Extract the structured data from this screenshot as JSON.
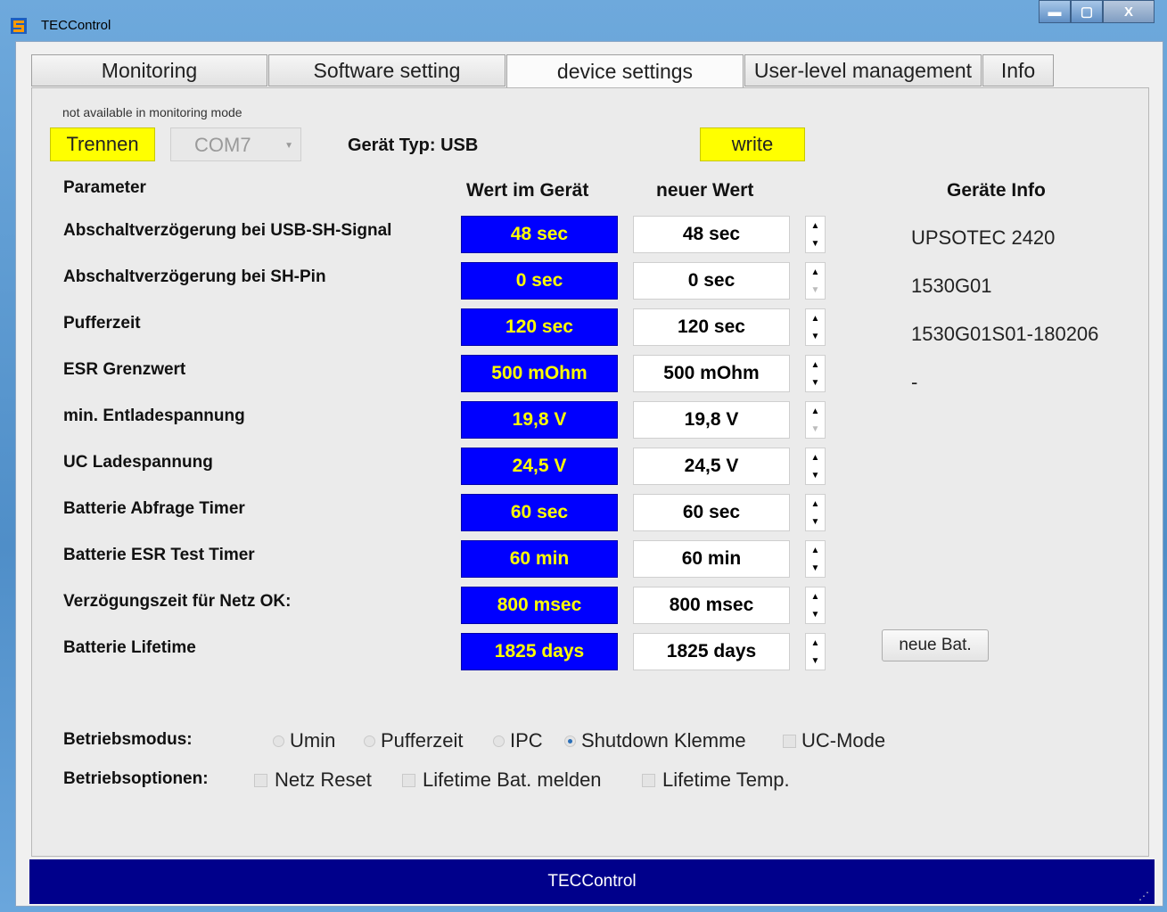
{
  "window": {
    "title": "TECControl"
  },
  "tabs": [
    {
      "label": "Monitoring"
    },
    {
      "label": "Software setting"
    },
    {
      "label": "device settings"
    },
    {
      "label": "User-level management"
    },
    {
      "label": "Info"
    }
  ],
  "toolbar": {
    "note": "not available in monitoring mode",
    "disconnect_label": "Trennen",
    "port_value": "COM7",
    "device_type": "Gerät Typ: USB",
    "write_label": "write"
  },
  "table": {
    "headers": {
      "parameter": "Parameter",
      "device_value": "Wert im Gerät",
      "new_value": "neuer Wert",
      "device_info": "Geräte Info"
    },
    "rows": [
      {
        "label": "Abschaltverzögerung bei USB-SH-Signal",
        "device": "48 sec",
        "new": "48 sec"
      },
      {
        "label": "Abschaltverzögerung bei SH-Pin",
        "device": "0 sec",
        "new": "0 sec"
      },
      {
        "label": "Pufferzeit",
        "device": "120 sec",
        "new": "120 sec"
      },
      {
        "label": "ESR Grenzwert",
        "device": "500 mOhm",
        "new": "500 mOhm"
      },
      {
        "label": "min. Entladespannung",
        "device": "19,8 V",
        "new": "19,8 V"
      },
      {
        "label": "UC Ladespannung",
        "device": "24,5 V",
        "new": "24,5 V"
      },
      {
        "label": "Batterie Abfrage Timer",
        "device": "60 sec",
        "new": "60 sec"
      },
      {
        "label": "Batterie ESR Test Timer",
        "device": "60 min",
        "new": "60 min"
      },
      {
        "label": "Verzögungszeit für Netz OK:",
        "device": "800 msec",
        "new": "800 msec"
      },
      {
        "label": "Batterie Lifetime",
        "device": "1825 days",
        "new": "1825 days"
      }
    ]
  },
  "device_info": [
    "UPSOTEC 2420",
    "1530G01",
    "1530G01S01-180206",
    "-"
  ],
  "new_battery_label": "neue Bat.",
  "mode": {
    "label": "Betriebsmodus:",
    "options": [
      {
        "label": "Umin",
        "selected": false
      },
      {
        "label": "Pufferzeit",
        "selected": false
      },
      {
        "label": "IPC",
        "selected": false
      },
      {
        "label": "Shutdown Klemme",
        "selected": true
      }
    ],
    "uc_mode_label": "UC-Mode"
  },
  "options": {
    "label": "Betriebsoptionen:",
    "items": [
      {
        "label": "Netz Reset",
        "checked": false
      },
      {
        "label": "Lifetime Bat. melden",
        "checked": false
      },
      {
        "label": "Lifetime Temp.",
        "checked": false
      }
    ]
  },
  "statusbar": {
    "text": "TECControl"
  }
}
